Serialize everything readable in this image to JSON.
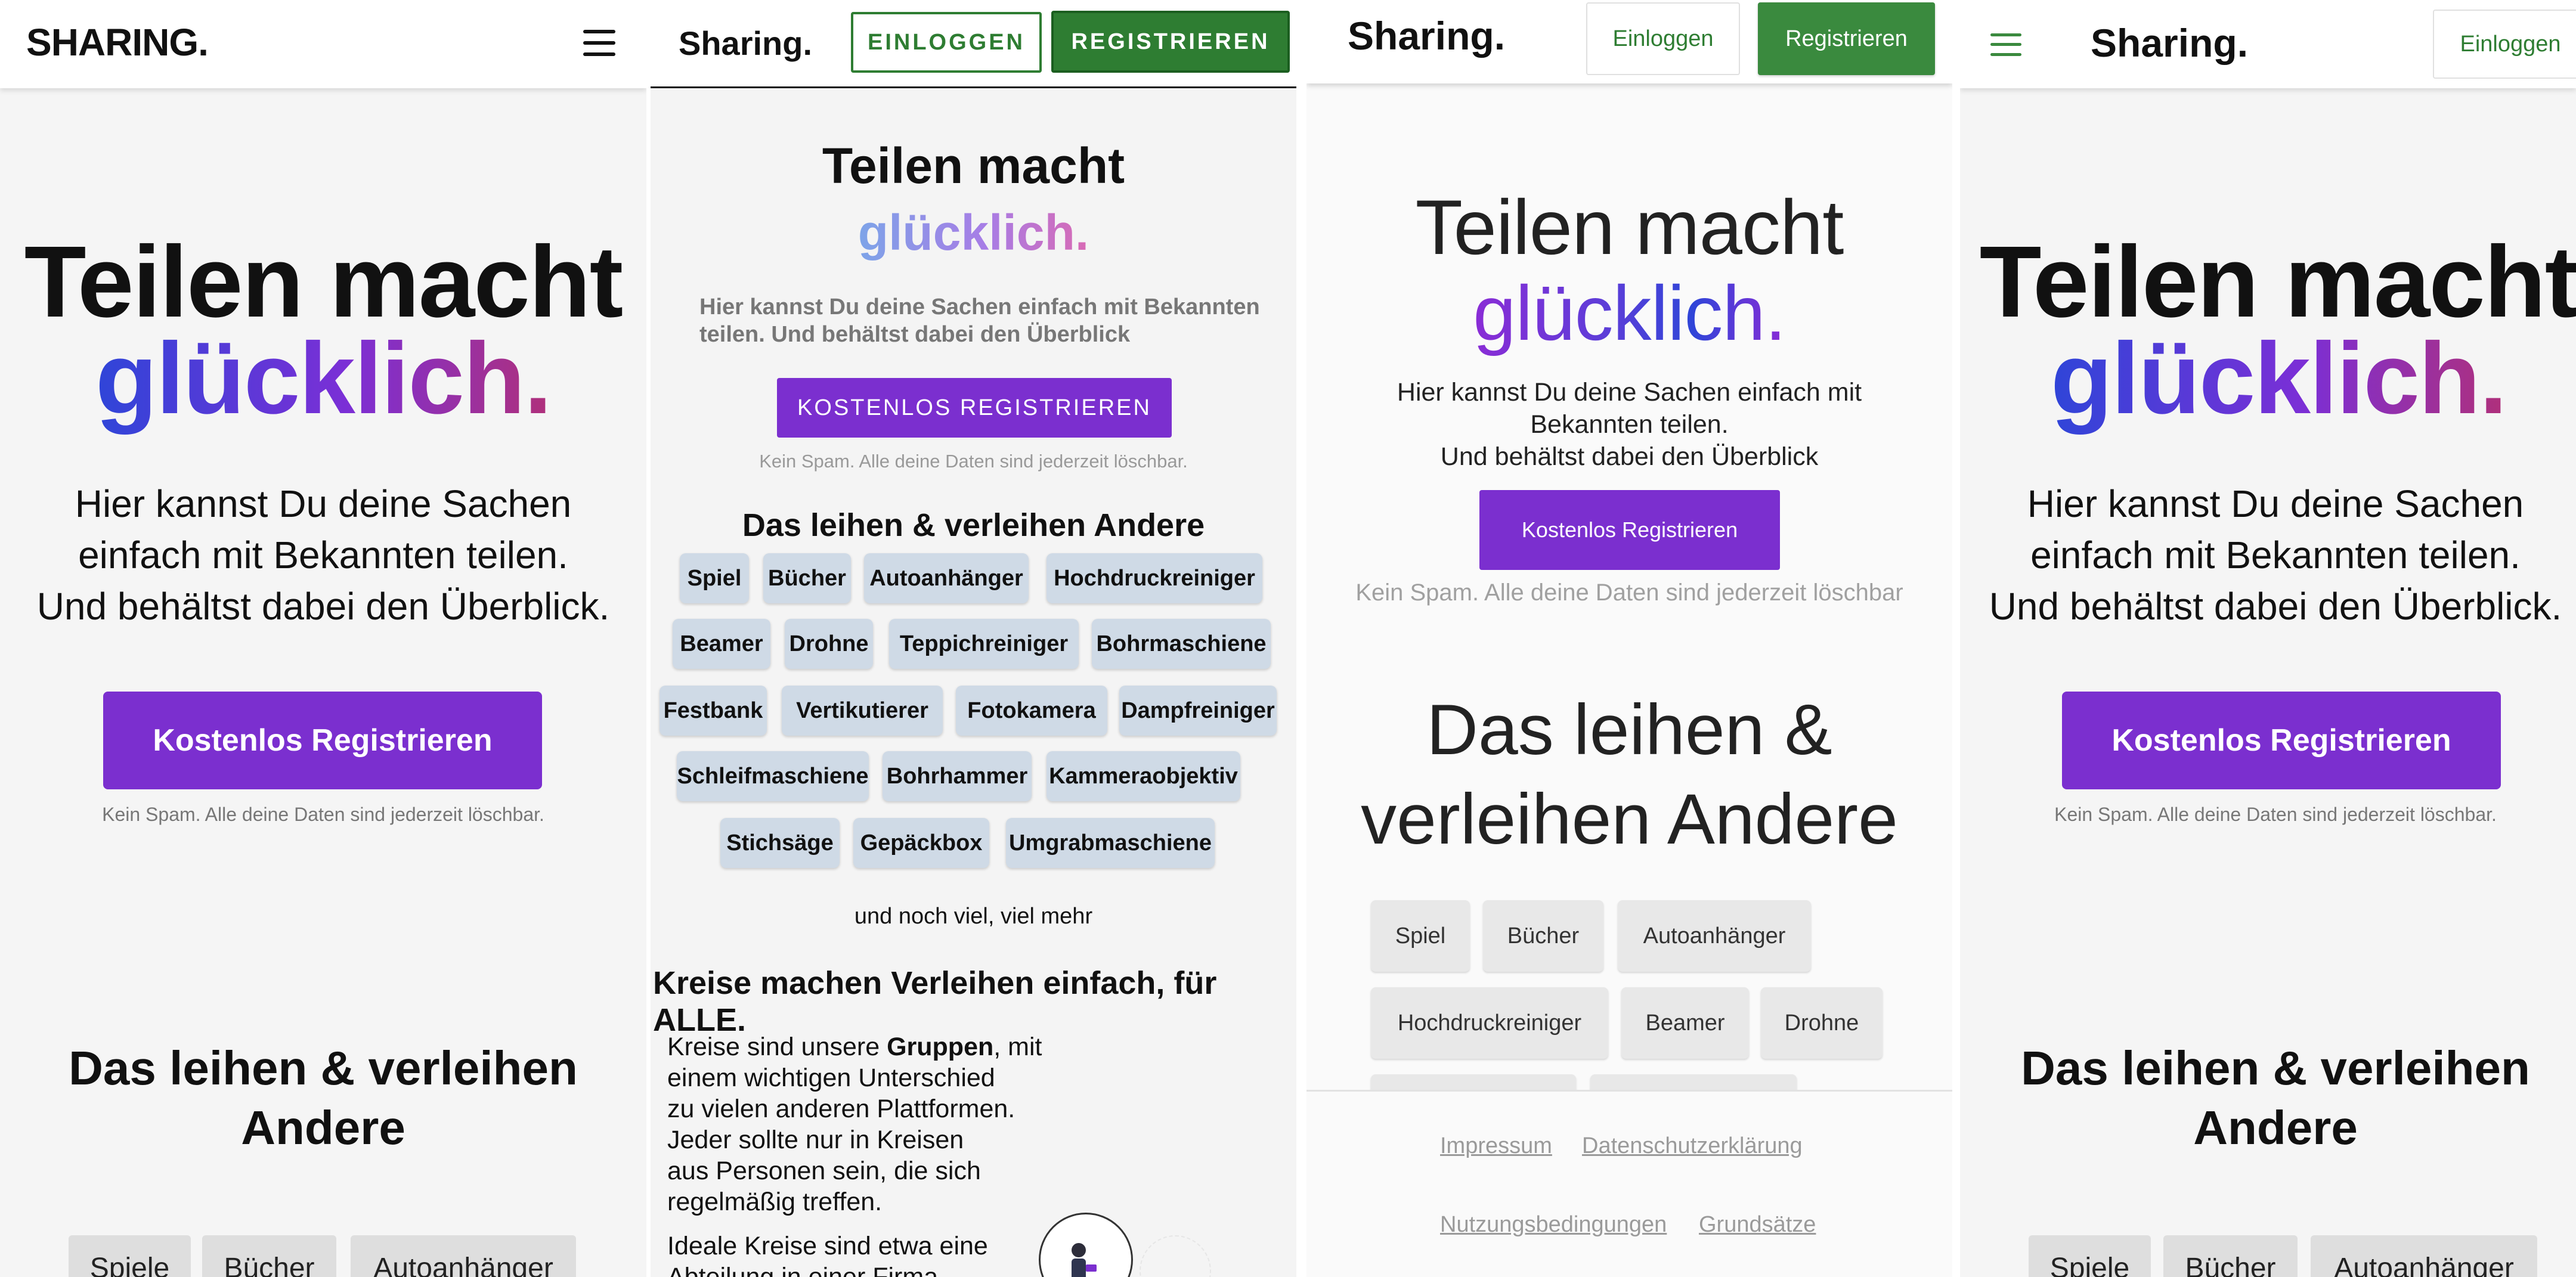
{
  "colors": {
    "accent_purple": "#7b2fcf",
    "green": "#2e7d32",
    "gradient_start": "#2f45d8",
    "gradient_mid": "#7b2fd6",
    "gradient_end": "#b0307a"
  },
  "panel1": {
    "logo": "SHARING.",
    "menu_icon": "hamburger-menu-icon",
    "title_line1": "Teilen macht",
    "title_line2": "glücklich.",
    "sub_line1": "Hier kannst Du deine Sachen",
    "sub_line2": "einfach mit Bekannten teilen.",
    "sub_line3": "Und behältst dabei den Überblick.",
    "cta": "Kostenlos Registrieren",
    "nospam": "Kein Spam. Alle deine Daten sind jederzeit löschbar.",
    "section_line1": "Das leihen & verleihen",
    "section_line2": "Andere",
    "chips": [
      "Spiele",
      "Bücher",
      "Autoanhänger"
    ]
  },
  "panel2": {
    "logo": "Sharing.",
    "login": "EINLOGGEN",
    "register": "REGISTRIEREN",
    "title_line1": "Teilen macht",
    "title_line2": "glücklich.",
    "sub_line1": "Hier kannst Du deine Sachen einfach mit Bekannten",
    "sub_line2": "teilen. Und behältst dabei den Überblick",
    "cta": "KOSTENLOS REGISTRIEREN",
    "nospam": "Kein Spam. Alle deine Daten sind jederzeit löschbar.",
    "section": "Das leihen & verleihen Andere",
    "chips": [
      "Spiel",
      "Bücher",
      "Autoanhänger",
      "Hochdruckreiniger",
      "Beamer",
      "Drohne",
      "Teppichreiniger",
      "Bohrmaschiene",
      "Festbank",
      "Vertikutierer",
      "Fotokamera",
      "Dampfreiniger",
      "Schleifmaschiene",
      "Bohrhammer",
      "Kammeraobjektiv",
      "Stichsäge",
      "Gepäckbox",
      "Umgrabmaschiene"
    ],
    "more": "und noch viel, viel mehr",
    "circles_heading": "Kreise machen Verleihen einfach, für ALLE.",
    "circles_p1_a": "Kreise sind unsere ",
    "circles_p1_b": "Gruppen",
    "circles_p1_c": ", mit",
    "circles_p1_l2": "einem wichtigen Unterschied",
    "circles_p1_l3": "zu vielen anderen Plattformen.",
    "circles_p1_l4": "Jeder sollte nur in Kreisen",
    "circles_p1_l5": "aus Personen sein, die sich",
    "circles_p1_l6": "regelmäßig treffen.",
    "circles_p2_l1": "Ideale Kreise sind etwa eine",
    "circles_p2_l2": "Abteilung in einer Firma"
  },
  "panel3": {
    "logo": "Sharing.",
    "login": "Einloggen",
    "register": "Registrieren",
    "title_line1": "Teilen macht",
    "title_line2": "glücklich.",
    "sub_line1": "Hier kannst Du deine Sachen einfach mit",
    "sub_line2": "Bekannten teilen.",
    "sub_line3": "Und behältst dabei den Überblick",
    "cta": "Kostenlos Registrieren",
    "nospam": "Kein Spam. Alle deine Daten sind jederzeit löschbar",
    "section_line1": "Das leihen &",
    "section_line2": "verleihen Andere",
    "chips": [
      "Spiel",
      "Bücher",
      "Autoanhänger",
      "Hochdruckreiniger",
      "Beamer",
      "Drohne"
    ],
    "footer_links": [
      "Impressum",
      "Datenschutzerklärung",
      "Nutzungsbedingungen",
      "Grundsätze"
    ]
  },
  "panel4": {
    "logo": "Sharing.",
    "login": "Einloggen",
    "menu_icon": "hamburger-menu-icon",
    "title_line1": "Teilen macht",
    "title_line2": "glücklich.",
    "sub_line1": "Hier kannst Du deine Sachen",
    "sub_line2": "einfach mit Bekannten teilen.",
    "sub_line3": "Und behältst dabei den Überblick.",
    "cta": "Kostenlos Registrieren",
    "nospam": "Kein Spam. Alle deine Daten sind jederzeit löschbar.",
    "section_line1": "Das leihen & verleihen",
    "section_line2": "Andere",
    "chips": [
      "Spiele",
      "Bücher",
      "Autoanhänger"
    ]
  }
}
